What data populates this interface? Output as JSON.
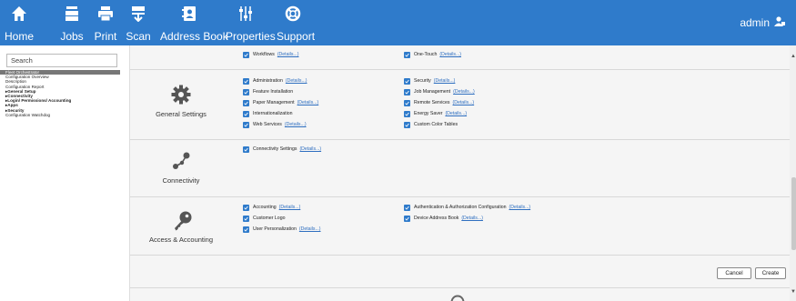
{
  "nav": {
    "home": "Home",
    "jobs": "Jobs",
    "print": "Print",
    "scan": "Scan",
    "address_book": "Address Book",
    "properties": "Properties",
    "support": "Support",
    "user": "admin"
  },
  "sidebar": {
    "search_placeholder": "Search",
    "items": [
      "Fleet Orchestrator",
      "Configuration Overview",
      "Description",
      "Configuration Report",
      "▸General Setup",
      "▸Connectivity",
      "▸Login/ Permissions/ Accounting",
      "▸Apps",
      "▸Security",
      "Configuration Watchdog"
    ]
  },
  "details_label": "(Details...)",
  "sections": {
    "top": {
      "left": [
        "Workflows"
      ],
      "right": [
        "One-Touch"
      ]
    },
    "general": {
      "title": "General Settings",
      "left": [
        "Administration",
        "Feature Installation",
        "Paper Management",
        "Internationalization",
        "Web Services"
      ],
      "right": [
        "Security",
        "Job Management",
        "Remote Services",
        "Energy Saver",
        "Custom Color Tables"
      ]
    },
    "connectivity": {
      "title": "Connectivity",
      "left": [
        "Connectivity Settings"
      ]
    },
    "access": {
      "title": "Access & Accounting",
      "left": [
        "Accounting",
        "Customer Logo",
        "User Personalization"
      ],
      "right": [
        "Authentication & Authorization Configuration",
        "Device Address Book"
      ]
    }
  },
  "buttons": {
    "cancel": "Cancel",
    "create": "Create"
  },
  "colors": {
    "topbar": "#2f7bcb",
    "checkbox": "#2f7bcb",
    "link": "#2f6fc0"
  }
}
